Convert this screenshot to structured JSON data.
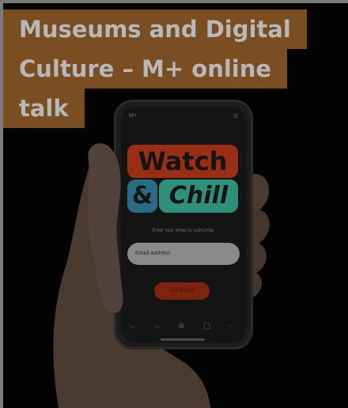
{
  "title": {
    "line1": "Museums and Digital",
    "line2": "Culture – M+ online",
    "line3": "talk"
  },
  "phone": {
    "logo": "M+",
    "menu_icon": "hamburger-menu",
    "headline_word1": "Watch",
    "headline_ampersand": "&",
    "headline_word2": "Chill",
    "subscribe_prompt": "Enter your email to subscribe.",
    "email_placeholder": "Email address",
    "submit_label": "Get Started"
  },
  "colors": {
    "title_bg": "#7a4d22",
    "title_text": "#b8b8b8",
    "watch_red": "#9a2e15",
    "ampersand_blue": "#2b6a85",
    "chill_green": "#2f8f78"
  }
}
